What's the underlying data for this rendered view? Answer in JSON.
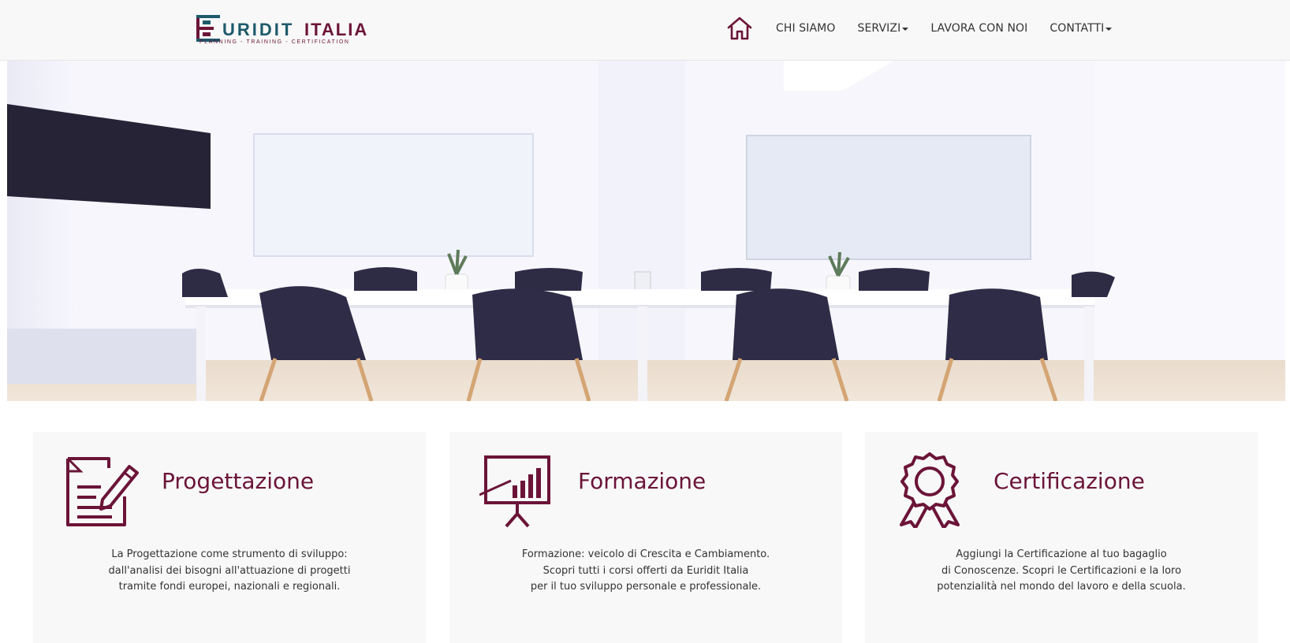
{
  "header": {
    "logo": {
      "text": "EURIDIT ITALIA",
      "tagline": "Planning - Training - Certification"
    },
    "nav": {
      "home_icon": "home-icon",
      "items": [
        {
          "label": "CHI SIAMO",
          "has_dropdown": false
        },
        {
          "label": "SERVIZI",
          "has_dropdown": true
        },
        {
          "label": "LAVORA CON NOI",
          "has_dropdown": false
        },
        {
          "label": "CONTATTI",
          "has_dropdown": true
        }
      ]
    }
  },
  "hero": {
    "image": "meeting-room-photo"
  },
  "services": [
    {
      "icon": "document-pencil-icon",
      "title": "Progettazione",
      "lines": [
        "La Progettazione come strumento di sviluppo:",
        "dall'analisi dei bisogni all'attuazione di progetti",
        "tramite fondi europei, nazionali e regionali."
      ]
    },
    {
      "icon": "presentation-chart-icon",
      "title": "Formazione",
      "lines": [
        "Formazione: veicolo di Crescita e Cambiamento.",
        "Scopri tutti i corsi offerti da Euridit Italia",
        "per il tuo sviluppo personale e professionale."
      ]
    },
    {
      "icon": "award-ribbon-icon",
      "title": "Certificazione",
      "lines": [
        "Aggiungi la Certificazione al tuo bagaglio",
        "di Conoscenze. Scopri le Certificazioni e la loro",
        "potenzialità nel mondo del lavoro e della scuola."
      ]
    }
  ],
  "colors": {
    "brand_maroon": "#6b1438",
    "logo_teal": "#1d5a6b",
    "navbar_bg": "#f8f8f8",
    "card_bg": "#f8f8f8"
  }
}
